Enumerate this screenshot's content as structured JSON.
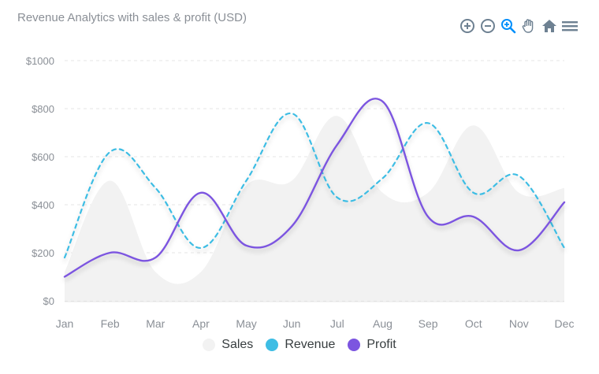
{
  "chart_data": {
    "type": "area",
    "title": "Revenue Analytics with sales & profit (USD)",
    "categories": [
      "Jan",
      "Feb",
      "Mar",
      "Apr",
      "May",
      "Jun",
      "Jul",
      "Aug",
      "Sep",
      "Oct",
      "Nov",
      "Dec"
    ],
    "ylim": [
      0,
      1000
    ],
    "yticks": [
      0,
      200,
      400,
      600,
      800,
      1000
    ],
    "ytick_labels": [
      "$0",
      "$200",
      "$400",
      "$600",
      "$800",
      "$1000"
    ],
    "grid": "horizontal dashed",
    "legend_position": "bottom",
    "series": [
      {
        "name": "Sales",
        "style": "area",
        "color": "#f2f2f2",
        "values": [
          120,
          500,
          120,
          120,
          480,
          500,
          770,
          450,
          450,
          730,
          450,
          470
        ]
      },
      {
        "name": "Revenue",
        "style": "dashed line",
        "color": "#3ebde4",
        "values": [
          180,
          620,
          470,
          220,
          500,
          780,
          430,
          510,
          740,
          450,
          520,
          220
        ]
      },
      {
        "name": "Profit",
        "style": "line",
        "color": "#7c55e0",
        "values": [
          100,
          200,
          180,
          450,
          230,
          310,
          650,
          830,
          350,
          350,
          210,
          410
        ]
      }
    ]
  },
  "toolbar": {
    "zoom_in_icon": "zoom-in-icon",
    "zoom_out_icon": "zoom-out-icon",
    "selection_zoom_icon": "magnifier-zoom-icon",
    "pan_icon": "hand-pan-icon",
    "reset_icon": "home-icon",
    "menu_icon": "menu-icon",
    "icon_color": "#6e8192",
    "active_icon_color": "#008ffb"
  }
}
